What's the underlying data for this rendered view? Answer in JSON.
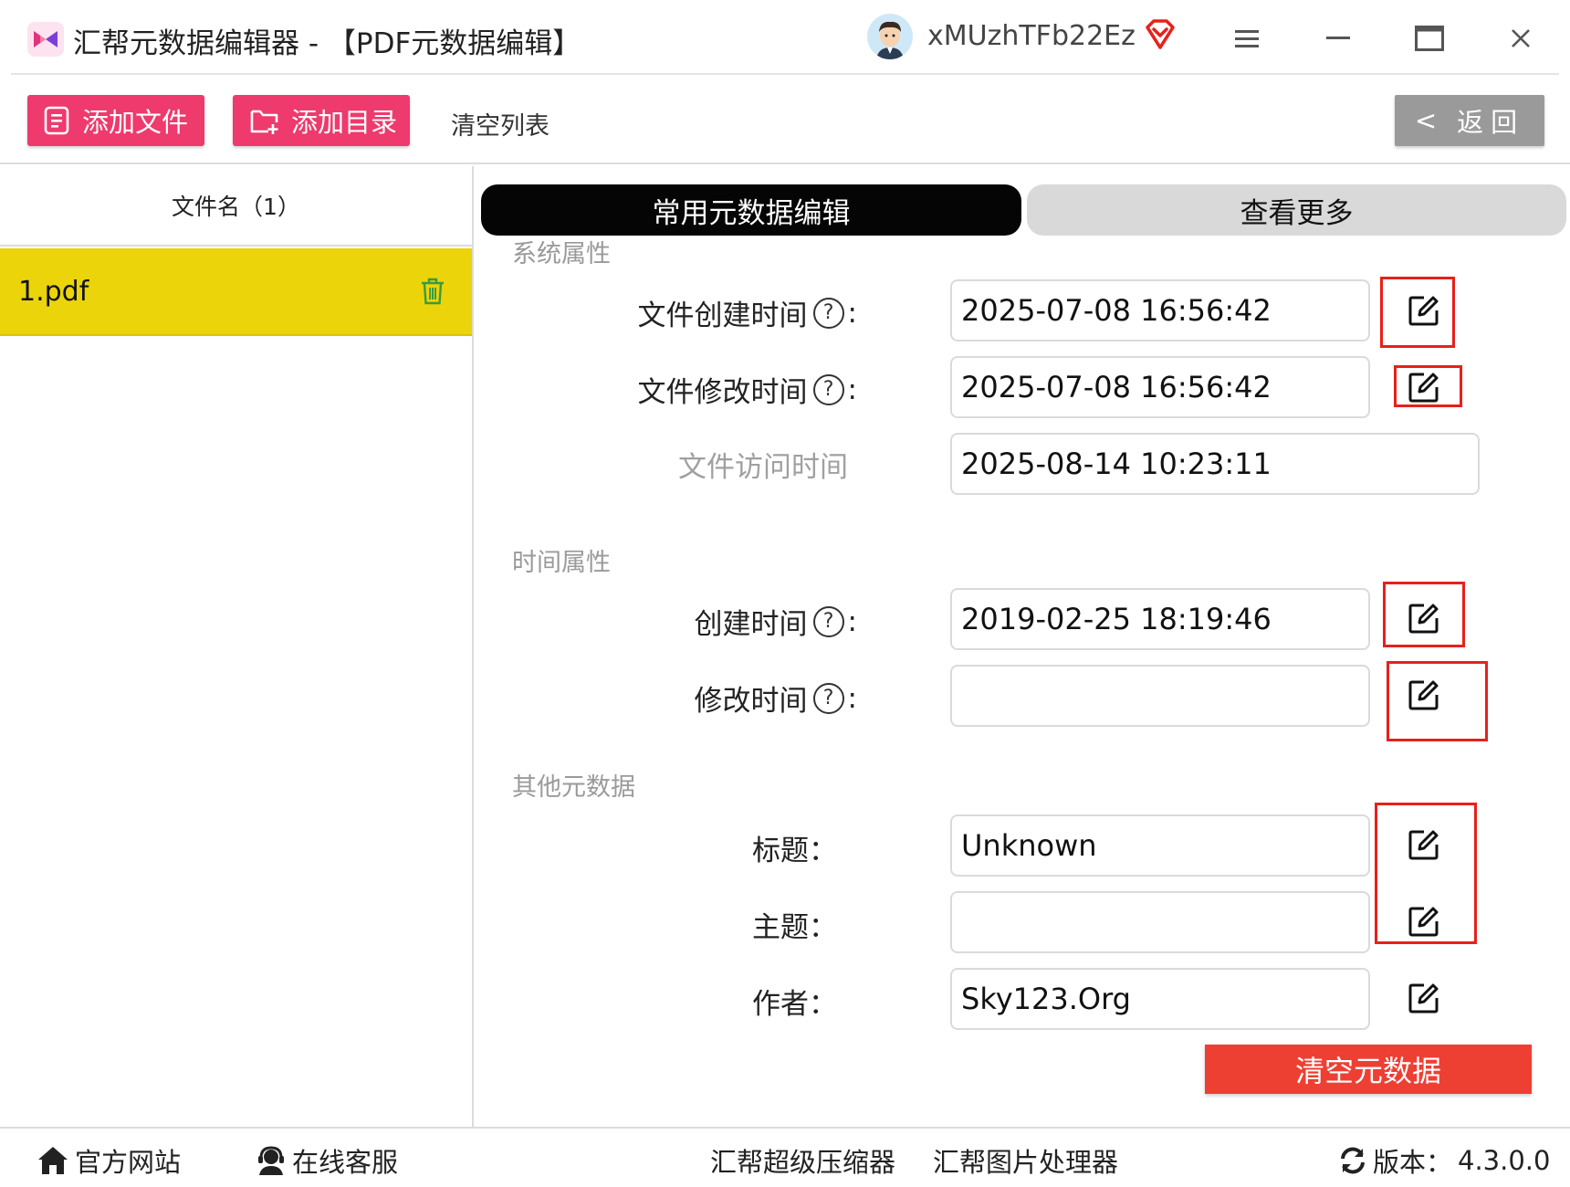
{
  "window": {
    "title": "汇帮元数据编辑器 - 【PDF元数据编辑】",
    "username": "xMUzhTFb22Ez"
  },
  "toolbar": {
    "add_file": "添加文件",
    "add_folder": "添加目录",
    "clear_list": "清空列表",
    "back": "返回",
    "back_chevron": "<"
  },
  "file_list": {
    "header": "文件名（1）",
    "items": [
      {
        "name": "1.pdf",
        "selected": true
      }
    ],
    "selected_color": "#ebd40a"
  },
  "tabs": {
    "active": "常用元数据编辑",
    "inactive": "查看更多"
  },
  "sections": {
    "system": {
      "title": "系统属性",
      "rows": [
        {
          "label": "文件创建时间",
          "help": "?",
          "value": "2025-07-08 16:56:42",
          "editable": true
        },
        {
          "label": "文件修改时间",
          "help": "?",
          "value": "2025-07-08 16:56:42",
          "editable": true
        },
        {
          "label": "文件访问时间",
          "value": "2025-08-14 10:23:11",
          "editable": false
        }
      ]
    },
    "time": {
      "title": "时间属性",
      "rows": [
        {
          "label": "创建时间",
          "help": "?",
          "value": "2019-02-25 18:19:46",
          "editable": true
        },
        {
          "label": "修改时间",
          "help": "?",
          "value": "",
          "editable": true
        }
      ]
    },
    "other": {
      "title": "其他元数据",
      "rows": [
        {
          "label": "标题：",
          "value": "Unknown",
          "editable": true
        },
        {
          "label": "主题：",
          "value": "",
          "editable": true
        },
        {
          "label": "作者：",
          "value": "Sky123.Org",
          "editable": true
        }
      ]
    }
  },
  "actions": {
    "clear_metadata": "清空元数据"
  },
  "footer": {
    "website": "官方网站",
    "support": "在线客服",
    "compressor": "汇帮超级压缩器",
    "image_tool": "汇帮图片处理器",
    "version_label": "版本：",
    "version": "4.3.0.0"
  },
  "colors": {
    "accent": "#ee3a6d",
    "highlight_box": "#e8201a",
    "clear_button": "#ee3f33",
    "tab_active": "#050505",
    "tab_inactive": "#d9d9d9"
  }
}
